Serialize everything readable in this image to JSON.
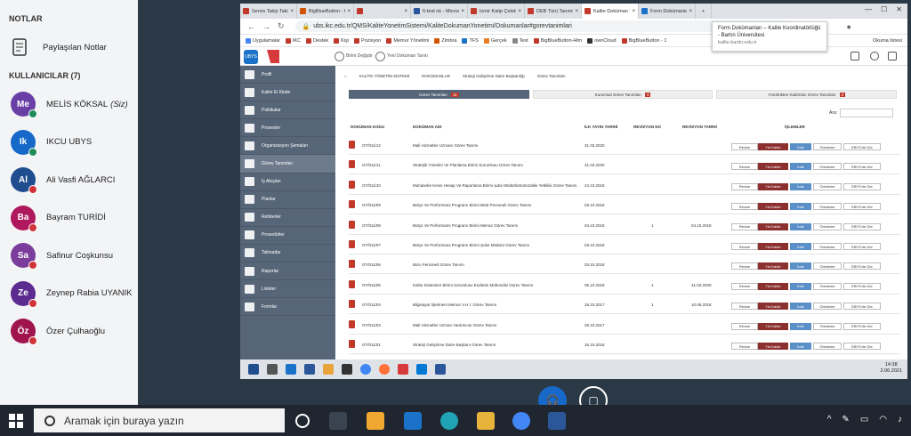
{
  "left_panel": {
    "notes_header": "NOTLAR",
    "shared_notes": "Paylaşılan Notlar",
    "users_header": "KULLANICILAR (7)",
    "users": [
      {
        "initials": "Me",
        "name": "MELİS KÖKSAL",
        "suffix": "(Siz)",
        "color": "#6a3fa5",
        "badge_color": "#1d8c5a"
      },
      {
        "initials": "Ik",
        "name": "IKCU UBYS",
        "suffix": "",
        "color": "#1669c9",
        "badge_color": "#1d8c5a"
      },
      {
        "initials": "Al",
        "name": "Ali Vasfi AĞLARCI",
        "suffix": "",
        "color": "#1f4e8f",
        "badge_color": "#d13438"
      },
      {
        "initials": "Ba",
        "name": "Bayram TURİDİ",
        "suffix": "",
        "color": "#b0185e",
        "badge_color": "#d13438"
      },
      {
        "initials": "Sa",
        "name": "Safinur Coşkunsu",
        "suffix": "",
        "color": "#7a3d9c",
        "badge_color": "#d13438"
      },
      {
        "initials": "Ze",
        "name": "Zeynep Rabia UYANIK",
        "suffix": "",
        "color": "#5b2b8f",
        "badge_color": "#d13438"
      },
      {
        "initials": "Öz",
        "name": "Özer Çulhaoğlu",
        "suffix": "",
        "color": "#a0144e",
        "badge_color": "#d13438"
      }
    ]
  },
  "browser": {
    "tabs": [
      {
        "label": "Servis Takip Takip İşlem",
        "color": "#c0392b"
      },
      {
        "label": "BigBlueButton - 6",
        "color": "#d35400"
      },
      {
        "label": "",
        "color": "#c0392b"
      },
      {
        "label": "6-test ok - Microsoft",
        "color": "#2b579a"
      },
      {
        "label": "İzmir Katip Çelebi Üni",
        "color": "#c0392b"
      },
      {
        "label": "DEB Türü Tanımlama",
        "color": "#c0392b"
      },
      {
        "label": "Kalite Doküman Yöne",
        "color": "#c0392b"
      },
      {
        "label": "Form Dokümanları - K",
        "color": "#1a73c8"
      }
    ],
    "url": "ubs.ikc.edu.tr/QMS/KaliteYonetimSistemi/KaliteDokumanYonetimi/Dokumanlar#gorevtanimlari",
    "bookmarks": [
      "Uygulamalar",
      "IKC",
      "Destek",
      "Kişi",
      "Pozisyon",
      "Memur Yönetimi",
      "Zimbra",
      "TFS",
      "Gerçek",
      "Test",
      "BigBlueButton-Hlm",
      "ownCloud",
      "BigBlueButton - 1"
    ],
    "reading_list": "Okuma listesi",
    "tooltip_title": "Form Dokümanları – Kalite Koordinatörlüğü - Bartın Üniversitesi",
    "tooltip_url": "kalite.bartin.edu.tr"
  },
  "app": {
    "header_btn1": "Birim Değiştir",
    "header_btn2": "Yeni Doküman Tanıtı",
    "sidebar": [
      "Profil",
      "Kalite El Kitabı",
      "Politikalar",
      "Prosesler",
      "Organizasyon Şemaları",
      "Görev Tanımları",
      "İş Akışları",
      "Planlar",
      "Rehberler",
      "Prosedürler",
      "Talimatlar",
      "Raporlar",
      "Listeler",
      "Formlar"
    ],
    "breadcrumb": [
      "KALİTE YÖNETİM SİSTEMİ",
      "DOKÜMANLAR",
      "Strateji Geliştirme Daire Başkanlığı",
      "Görev Tanımları"
    ],
    "subtabs": [
      {
        "label": "Görev Tanımları",
        "count": "11"
      },
      {
        "label": "Kurumsal Görev Tanımları",
        "count": "4"
      },
      {
        "label": "Yürürlükten Kaldırılan Görev Tanımları",
        "count": "2"
      }
    ],
    "search_label": "Ara:",
    "columns": [
      "DOKÜMAN KODU",
      "DOKÜMAN ADI",
      "İLK YAYIN TARİHİ",
      "REVİZYON NO",
      "REVİZYON TARİHİ",
      "İŞLEMLER"
    ],
    "actions": [
      "Revize",
      "Yür.Kaldır",
      "İndir",
      "Önizleme",
      "EBYS'de Gör"
    ],
    "rows": [
      {
        "code": "GT/011/12",
        "name": "Mali Hizmetler Uzmanı Görev Tanımı",
        "date": "31.03.2020",
        "rev": "",
        "revdate": ""
      },
      {
        "code": "GT/011/11",
        "name": "Stratejik Yönetim Ve Planlama Birimi Sorumlusu Görev Tanımı",
        "date": "31.03.2020",
        "rev": "",
        "revdate": ""
      },
      {
        "code": "GT/011/10",
        "name": "Muhasebe Kesin Hesap Ve Raporlama Birimi şube Müdürlümünüzdeki Yetkilisi Görev Tanımı",
        "date": "24.10.2018",
        "rev": "",
        "revdate": ""
      },
      {
        "code": "GT/011/09",
        "name": "Bütçe Ve Performans Programı Birimi Bütü Personeli Görev Tanımı",
        "date": "03.10.2018",
        "rev": "",
        "revdate": ""
      },
      {
        "code": "GT/011/08",
        "name": "Bütçe Ve Performans Programı Birimi Memur Görev Tanımı",
        "date": "04.10.2018",
        "rev": "1",
        "revdate": "04.10.2018"
      },
      {
        "code": "GT/011/07",
        "name": "Bütçe Ve Performans Programı Birimi Şube Müdürü Görev Tanımı",
        "date": "03.10.2018",
        "rev": "",
        "revdate": ""
      },
      {
        "code": "GT/011/06",
        "name": "Büro Personeli Görev Tanımı",
        "date": "03.10.2018",
        "rev": "",
        "revdate": ""
      },
      {
        "code": "GT/011/05",
        "name": "Kalite Sistemleri Birimi Sorumlusu Endüstri Mühendisi Görev Tanımı",
        "date": "05.10.2018",
        "rev": "1",
        "revdate": "31.03.2020"
      },
      {
        "code": "GT/011/04",
        "name": "Bilgisayar İşletmeni Memur V.H.İ. Görev Tanımı",
        "date": "28.10.2017",
        "rev": "1",
        "revdate": "10.08.2018"
      },
      {
        "code": "GT/011/03",
        "name": "Mali Hizmetler Uzman Yardımcısı Görev Tanımı",
        "date": "28.10.2017",
        "rev": "",
        "revdate": ""
      },
      {
        "code": "GT/011/01",
        "name": "Strateji Geliştirme Daire Başkanı Görev Tanımı",
        "date": "16.10.2018",
        "rev": "",
        "revdate": ""
      }
    ]
  },
  "inner_taskbar": {
    "time": "14:38",
    "date": "2.06.2021"
  },
  "taskbar": {
    "search_placeholder": "Aramak için buraya yazın"
  }
}
